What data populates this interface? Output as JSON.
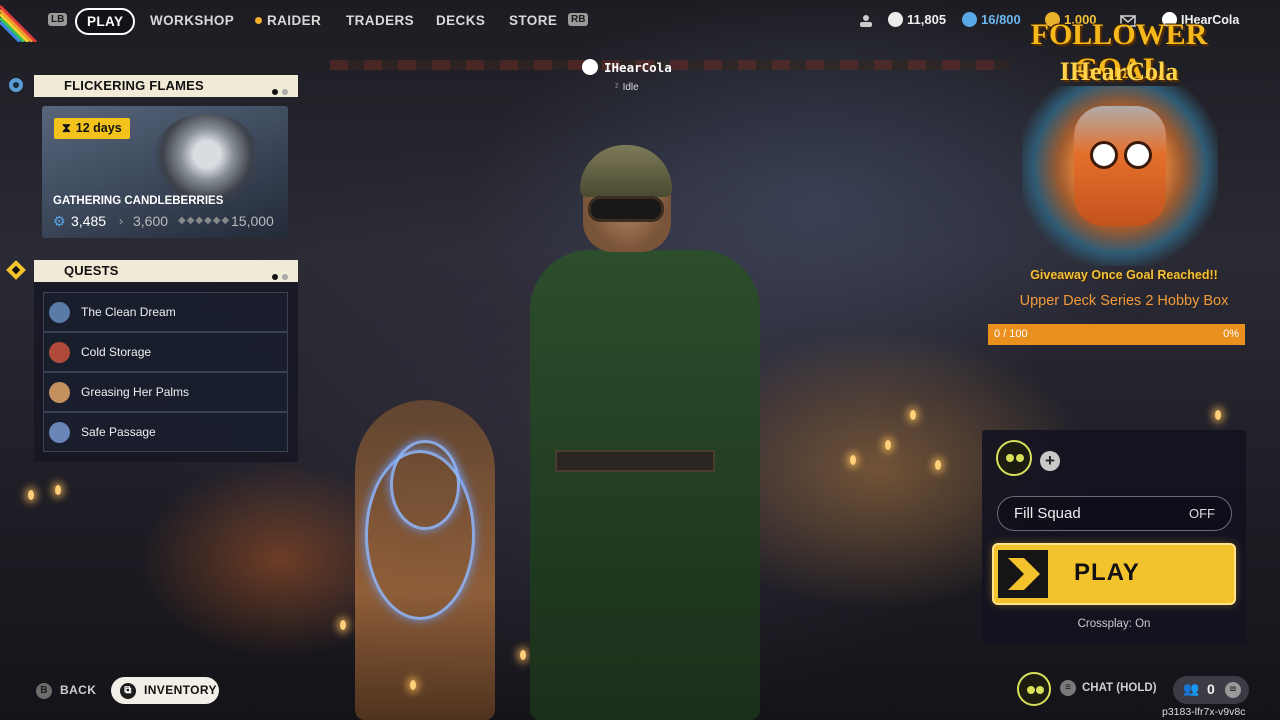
{
  "nav": {
    "left_key": "LB",
    "right_key": "RB",
    "items": [
      {
        "label": "PLAY",
        "active": true
      },
      {
        "label": "WORKSHOP"
      },
      {
        "label": "RAIDER"
      },
      {
        "label": "TRADERS"
      },
      {
        "label": "DECKS"
      },
      {
        "label": "STORE"
      }
    ],
    "stats": {
      "credits": "11,805",
      "tokens": "16/800",
      "coins": "1,000",
      "username": "IHearCola"
    }
  },
  "event": {
    "title": "FLICKERING FLAMES",
    "timer_value": "12",
    "timer_unit": "days",
    "name": "GATHERING CANDLEBERRIES",
    "current": "3,485",
    "next": "3,600",
    "max": "15,000"
  },
  "quests": {
    "title": "QUESTS",
    "items": [
      {
        "label": "The Clean Dream",
        "color": "#5a7aa8"
      },
      {
        "label": "Cold Storage",
        "color": "#b04a3a"
      },
      {
        "label": "Greasing Her Palms",
        "color": "#c49060"
      },
      {
        "label": "Safe Passage",
        "color": "#6a86b8"
      }
    ]
  },
  "player": {
    "name": "IHearCola",
    "status": "Idle"
  },
  "goal": {
    "title": "FOLLOWER GOAL",
    "name": "IHearCola",
    "giveaway": "Giveaway Once Goal Reached!!",
    "prize": "Upper Deck Series 2 Hobby Box",
    "progress_text": "0 / 100",
    "percent": "0%",
    "progress": 0
  },
  "squad": {
    "fill_label": "Fill Squad",
    "fill_value": "OFF",
    "play_label": "PLAY",
    "crossplay": "Crossplay: On"
  },
  "bottom": {
    "back_key": "B",
    "back_label": "BACK",
    "inventory_label": "INVENTORY",
    "chat_label": "CHAT (HOLD)",
    "friends_count": "0",
    "session_code": "p3183-lfr7x-v9v8c"
  },
  "colors": {
    "accent_yellow": "#f2c32c",
    "goal_orange": "#e9901e",
    "panel_cream": "#f1ead7"
  }
}
